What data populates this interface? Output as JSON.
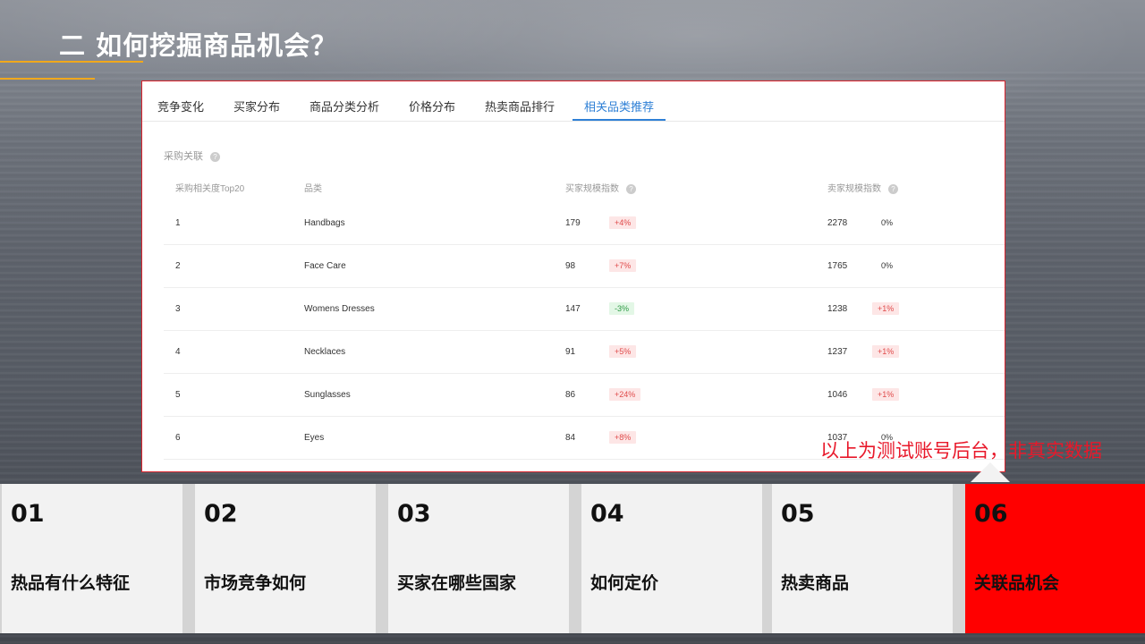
{
  "slide": {
    "title": "二 如何挖掘商品机会？"
  },
  "tabs": [
    {
      "label": "竞争变化"
    },
    {
      "label": "买家分布"
    },
    {
      "label": "商品分类分析"
    },
    {
      "label": "价格分布"
    },
    {
      "label": "热卖商品排行"
    },
    {
      "label": "相关品类推荐",
      "active": true
    }
  ],
  "section": {
    "label": "采购关联",
    "help_glyph": "?"
  },
  "table": {
    "headers": {
      "rank": "采购相关度Top20",
      "category": "品类",
      "buyer_index": "买家规模指数",
      "seller_index": "卖家规模指数"
    },
    "rows": [
      {
        "rank": "1",
        "category": "Handbags",
        "buyer": "179",
        "buyer_change": "+4%",
        "seller": "2278",
        "seller_change": "0%"
      },
      {
        "rank": "2",
        "category": "Face Care",
        "buyer": "98",
        "buyer_change": "+7%",
        "seller": "1765",
        "seller_change": "0%"
      },
      {
        "rank": "3",
        "category": "Womens Dresses",
        "buyer": "147",
        "buyer_change": "-3%",
        "seller": "1238",
        "seller_change": "+1%"
      },
      {
        "rank": "4",
        "category": "Necklaces",
        "buyer": "91",
        "buyer_change": "+5%",
        "seller": "1237",
        "seller_change": "+1%"
      },
      {
        "rank": "5",
        "category": "Sunglasses",
        "buyer": "86",
        "buyer_change": "+24%",
        "seller": "1046",
        "seller_change": "+1%"
      },
      {
        "rank": "6",
        "category": "Eyes",
        "buyer": "84",
        "buyer_change": "+8%",
        "seller": "1037",
        "seller_change": "0%"
      }
    ]
  },
  "disclaimer": "以上为测试账号后台，非真实数据",
  "nav": [
    {
      "num": "01",
      "label": "热品有什么特征"
    },
    {
      "num": "02",
      "label": "市场竞争如何"
    },
    {
      "num": "03",
      "label": "买家在哪些国家"
    },
    {
      "num": "04",
      "label": "如何定价"
    },
    {
      "num": "05",
      "label": "热卖商品"
    },
    {
      "num": "06",
      "label": "关联品机会",
      "active": true
    }
  ],
  "colors": {
    "accent_orange": "#f0a81c",
    "panel_border": "#d9232d",
    "tab_active": "#2f80d6",
    "badge_up_bg": "#fde6e6",
    "badge_up_text": "#e04b4b",
    "badge_down_bg": "#e3f7e6",
    "badge_down_text": "#2f9a46",
    "nav_active": "#ff0000",
    "disclaimer": "#e8182a"
  }
}
